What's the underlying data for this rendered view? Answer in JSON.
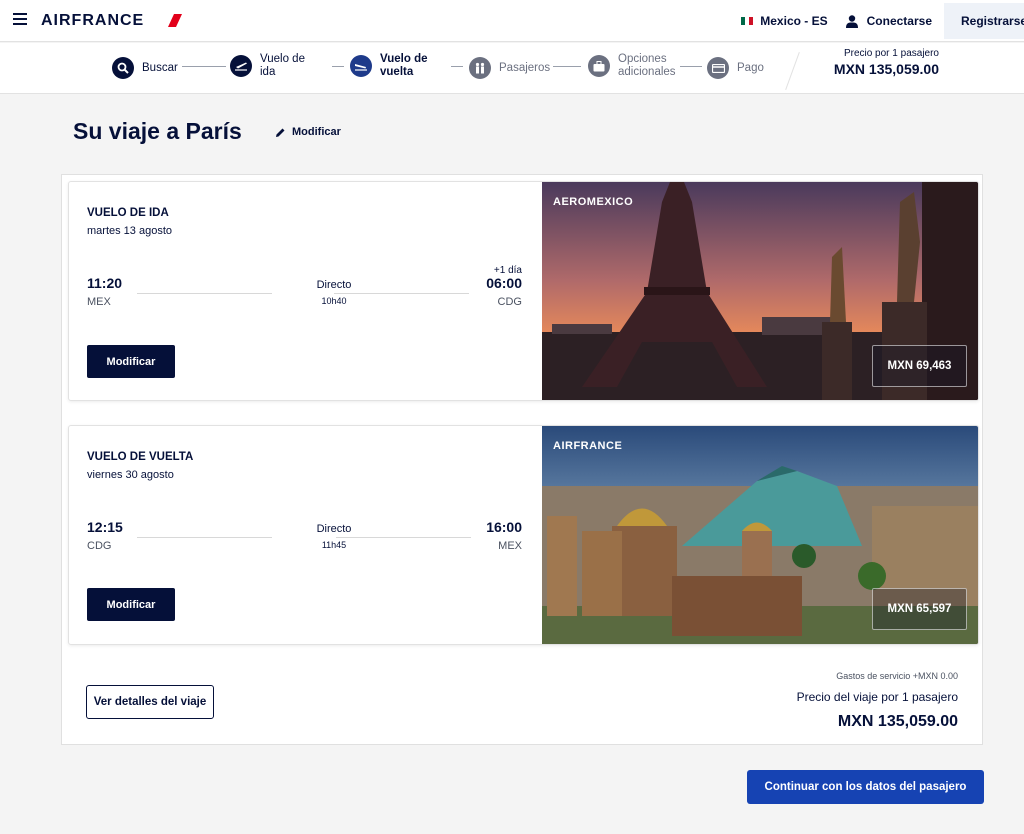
{
  "header": {
    "brand": "AIRFRANCE",
    "language": "Mexico - ES",
    "login": "Conectarse",
    "register": "Registrarse",
    "icons": [
      "menu-icon",
      "mexico-flag-icon",
      "user-icon",
      "add-user-icon"
    ]
  },
  "stepper": {
    "steps": [
      {
        "label": "Buscar",
        "state": "done",
        "icon": "search-icon"
      },
      {
        "label": "Vuelo de ida",
        "state": "done",
        "icon": "plane-takeoff-icon"
      },
      {
        "label": "Vuelo de vuelta",
        "state": "active",
        "icon": "plane-landing-icon"
      },
      {
        "label": "Pasajeros",
        "state": "pending",
        "icon": "passengers-icon"
      },
      {
        "label": "Opciones adicionales",
        "state": "pending",
        "icon": "suitcase-icon"
      },
      {
        "label": "Pago",
        "state": "pending",
        "icon": "card-icon"
      }
    ],
    "price_label": "Precio por 1 pasajero",
    "price_value": "MXN 135,059.00"
  },
  "page": {
    "title": "Su viaje a París",
    "modify_label": "Modificar"
  },
  "outbound": {
    "title": "VUELO DE IDA",
    "date": "martes 13 agosto",
    "dep_time": "11:20",
    "dep_code": "MEX",
    "route_type": "Directo",
    "duration": "10h40",
    "day_offset": "+1 día",
    "arr_time": "06:00",
    "arr_code": "CDG",
    "modify_button": "Modificar",
    "carrier": "AEROMEXICO",
    "price": "MXN 69,463"
  },
  "inbound": {
    "title": "VUELO DE VUELTA",
    "date": "viernes 30 agosto",
    "dep_time": "12:15",
    "dep_code": "CDG",
    "route_type": "Directo",
    "duration": "11h45",
    "arr_time": "16:00",
    "arr_code": "MEX",
    "modify_button": "Modificar",
    "carrier": "AIRFRANCE",
    "price": "MXN 65,597"
  },
  "summary": {
    "fees": "Gastos de servicio +MXN 0.00",
    "trip_label": "Precio del viaje por 1 pasajero",
    "trip_value": "MXN 135,059.00",
    "details_button": "Ver detalles del viaje",
    "continue_button": "Continuar con los datos del pasajero"
  },
  "colors": {
    "navy": "#051039",
    "accent_blue": "#1643b3",
    "background": "#f4f4f4"
  }
}
